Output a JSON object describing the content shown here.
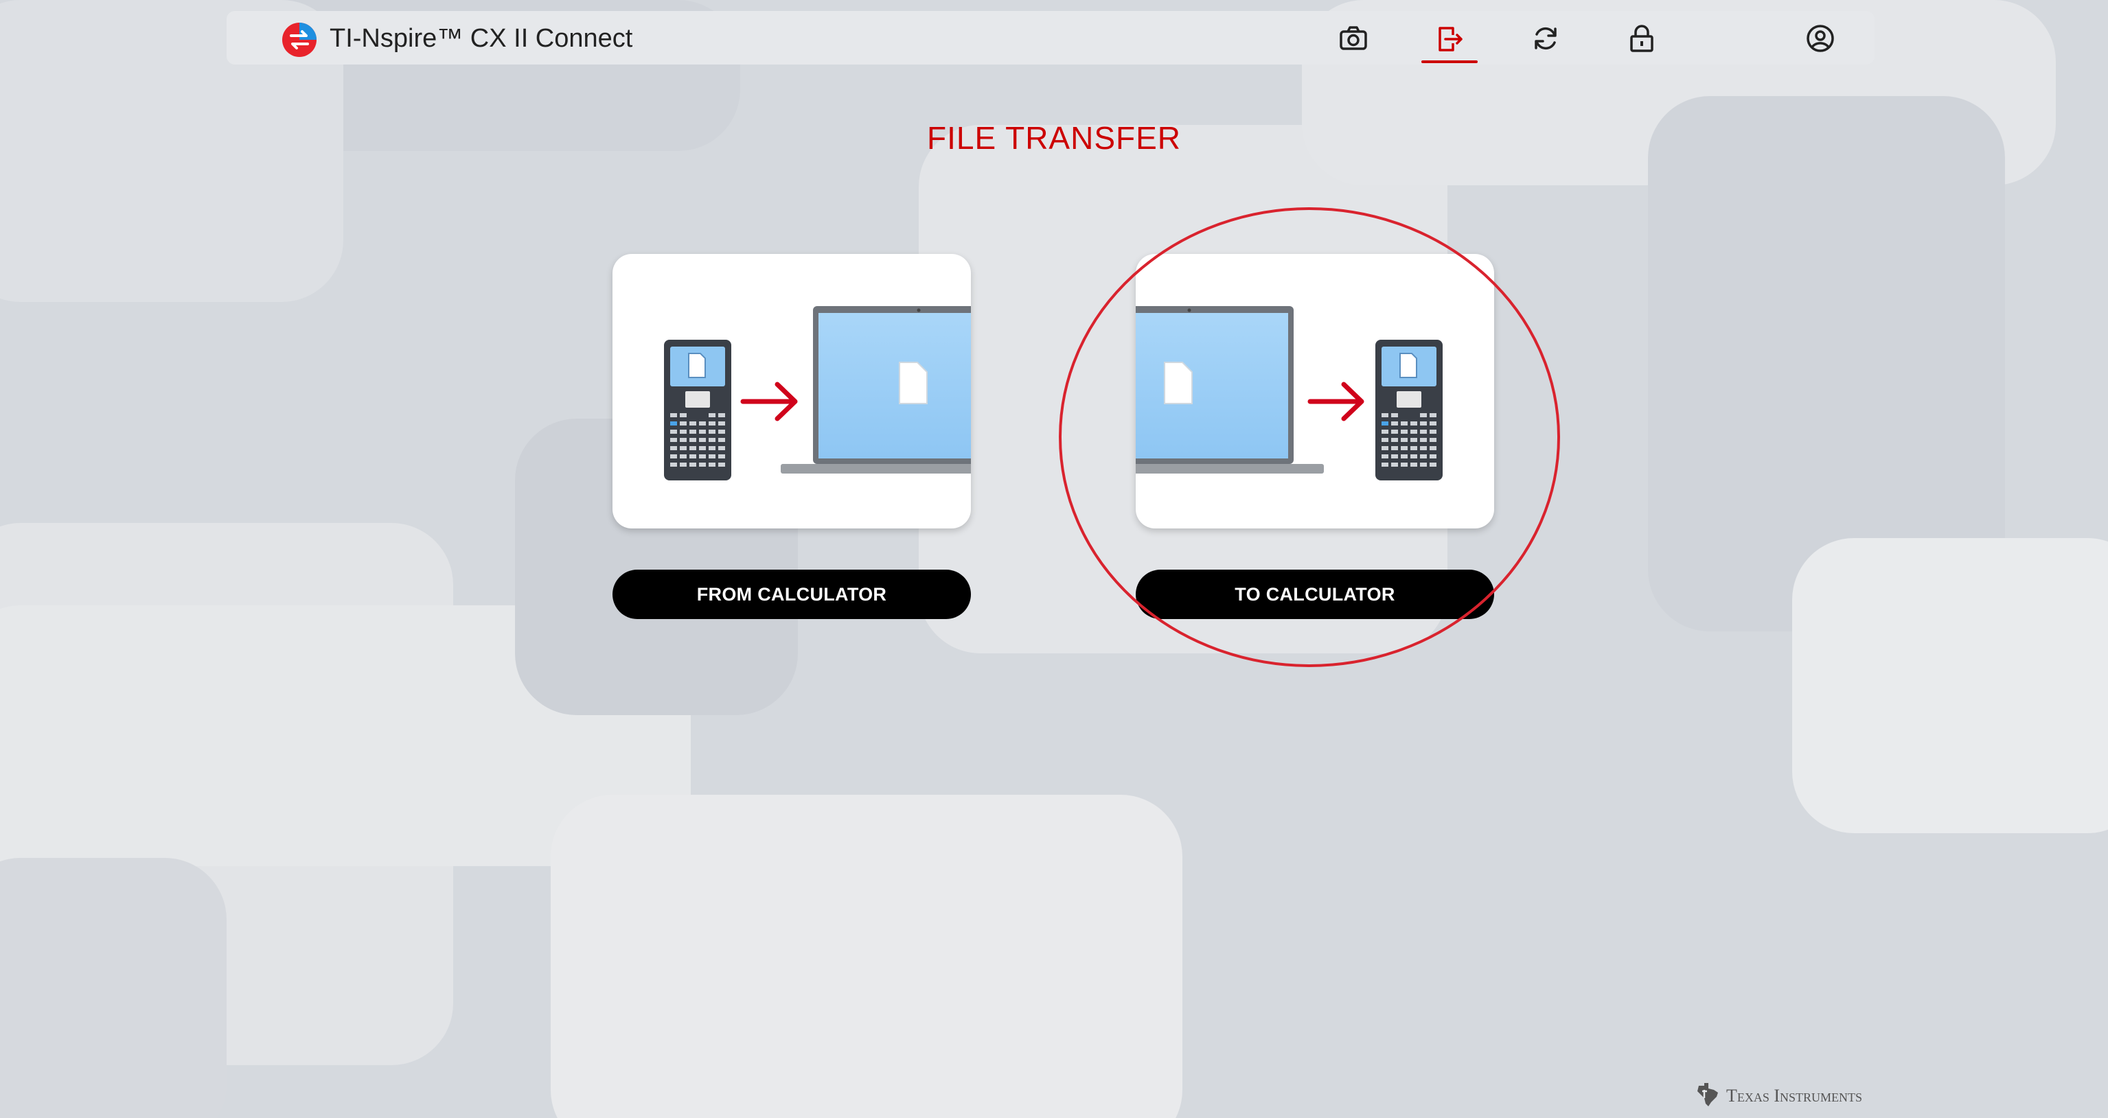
{
  "app": {
    "title": "TI-Nspire™ CX II Connect",
    "logo_icon": "ti-connect-logo-icon"
  },
  "header": {
    "icons": [
      {
        "name": "camera-icon",
        "label": "screen capture"
      },
      {
        "name": "file-transfer-icon",
        "label": "file transfer",
        "active": true
      },
      {
        "name": "refresh-icon",
        "label": "update"
      },
      {
        "name": "lock-icon",
        "label": "exam mode"
      },
      {
        "name": "account-icon",
        "label": "account"
      }
    ],
    "active_color": "#cc0000"
  },
  "page": {
    "title": "FILE TRANSFER"
  },
  "options": [
    {
      "id": "from",
      "button_label": "FROM CALCULATOR"
    },
    {
      "id": "to",
      "button_label": "TO CALCULATOR"
    }
  ],
  "footer": {
    "brand": "Texas Instruments"
  },
  "colors": {
    "accent": "#cc0000",
    "button_bg": "#000000",
    "button_text": "#ffffff",
    "annotation_circle": "#d9232e"
  }
}
